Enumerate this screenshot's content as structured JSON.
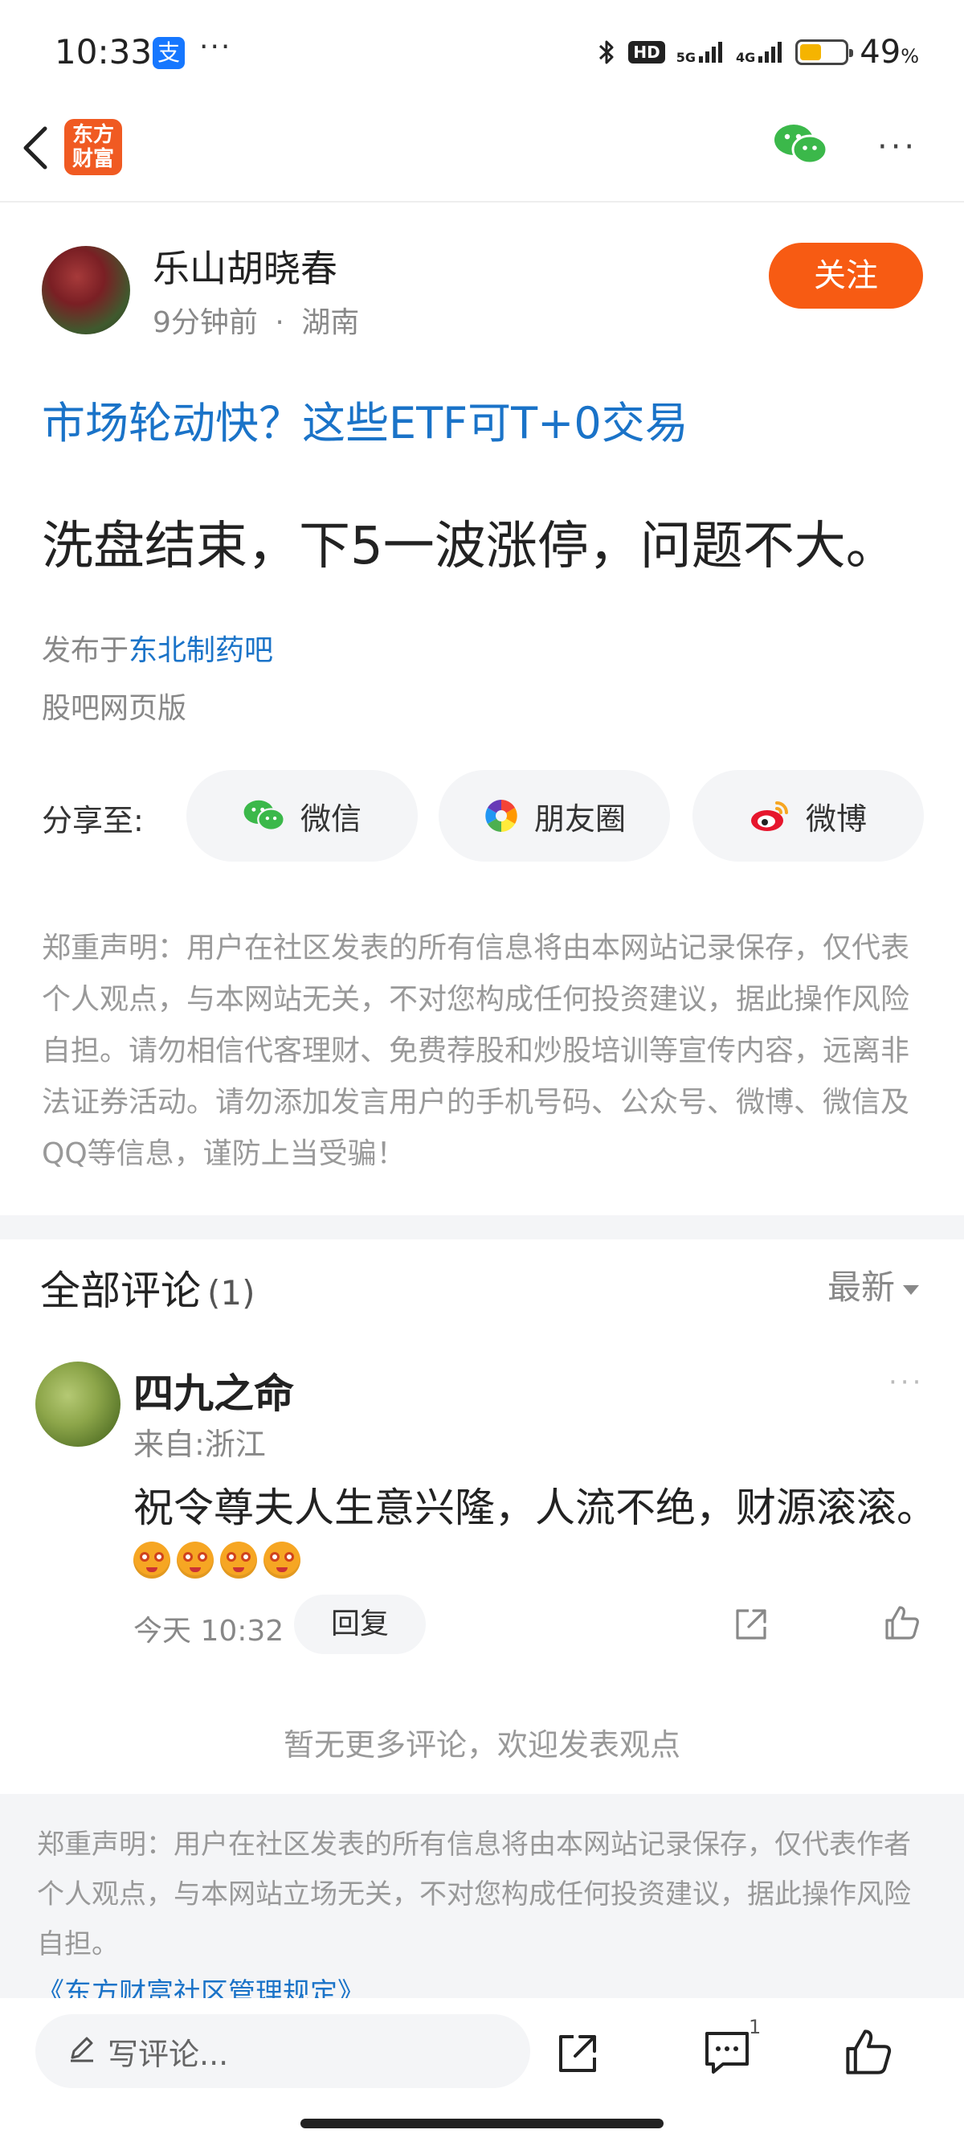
{
  "status_bar": {
    "time": "10:33",
    "app_badge": "支",
    "dots": "···",
    "hd_label": "HD",
    "net_5g": "5G",
    "net_4g": "4G",
    "battery_percent": "49",
    "battery_unit": "%",
    "battery_level": 0.49
  },
  "header": {
    "logo_line1": "东方",
    "logo_line2": "财富",
    "more": "···"
  },
  "author": {
    "name": "乐山胡晓春",
    "time_ago": "9分钟前",
    "separator": "·",
    "location": "湖南",
    "follow_label": "关注"
  },
  "post": {
    "headline": "市场轮动快？这些ETF可T+0交易",
    "body": "洗盘结束，下5一波涨停，问题不大。",
    "published_prefix": "发布于",
    "bar_name": "东北制药吧",
    "source": "股吧网页版"
  },
  "share": {
    "label": "分享至:",
    "wechat": "微信",
    "moments": "朋友圈",
    "weibo": "微博"
  },
  "disclaimer": "郑重声明：用户在社区发表的所有信息将由本网站记录保存，仅代表个人观点，与本网站无关，不对您构成任何投资建议，据此操作风险自担。请勿相信代客理财、免费荐股和炒股培训等宣传内容，远离非法证券活动。请勿添加发言用户的手机号码、公众号、微博、微信及QQ等信息，谨防上当受骗！",
  "comments": {
    "title": "全部评论",
    "count": "(1)",
    "sort_label": "最新",
    "items": [
      {
        "name": "四九之命",
        "location": "来自:浙江",
        "text": "祝令尊夫人生意兴隆，人流不绝，财源滚滚。",
        "time": "今天 10:32",
        "reply_label": "回复",
        "more": "···"
      }
    ],
    "no_more": "暂无更多评论，欢迎发表观点"
  },
  "footer": {
    "disclaimer": "郑重声明：用户在社区发表的所有信息将由本网站记录保存，仅代表作者个人观点，与本网站立场无关，不对您构成任何投资建议，据此操作风险自担。",
    "rules_link": "《东方财富社区管理规定》"
  },
  "bottom_bar": {
    "input_placeholder": "写评论...",
    "comment_count": "1"
  },
  "colors": {
    "brand_orange": "#f05a22",
    "follow_orange": "#f75b13",
    "link_blue": "#1a73c8"
  }
}
